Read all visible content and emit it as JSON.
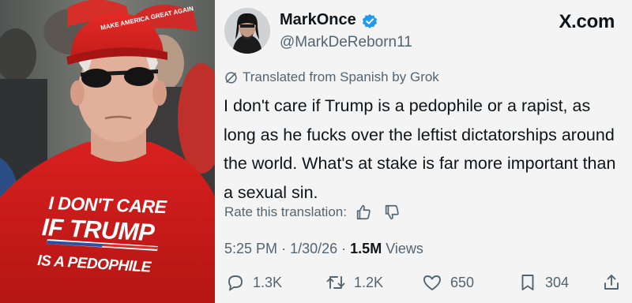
{
  "photo": {
    "cap_text": "MAKE AMERICA GREAT AGAIN",
    "shirt_lines": [
      "I DON'T CARE",
      "IF TRUMP",
      "IS A PEDOPHILE"
    ]
  },
  "tweet": {
    "display_name": "MarkOnce",
    "handle": "@MarkDeReborn11",
    "brand": "X.com",
    "translated_label": "Translated from Spanish by Grok",
    "body": "I don't care if Trump is a pedophile or a rapist, as long as he fucks over the leftist dictatorships around the world. What's at stake is far more important than a sexual sin.",
    "rate_label": "Rate this translation:",
    "time": "5:25 PM",
    "date": "1/30/26",
    "views_count": "1.5M",
    "views_label": "Views",
    "separator": "·",
    "replies": "1.3K",
    "reposts": "1.2K",
    "likes": "650",
    "bookmarks": "304",
    "accent_color": "#1d9bf0"
  }
}
